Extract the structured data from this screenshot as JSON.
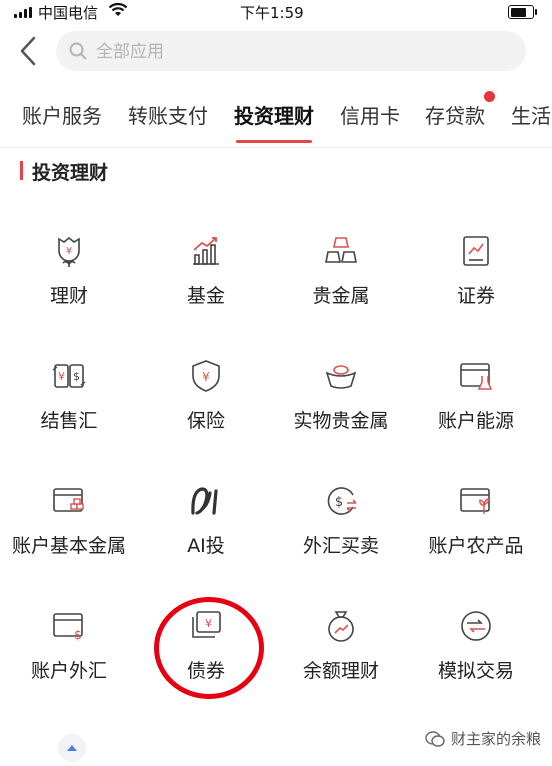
{
  "status_bar": {
    "carrier": "中国电信",
    "time": "下午1:59",
    "battery_level": 0.8
  },
  "search": {
    "placeholder": "全部应用"
  },
  "tabs": [
    {
      "label": "账户服务",
      "active": false
    },
    {
      "label": "转账支付",
      "active": false
    },
    {
      "label": "投资理财",
      "active": true
    },
    {
      "label": "信用卡",
      "active": false
    },
    {
      "label": "存贷款",
      "active": false,
      "has_badge": true
    },
    {
      "label": "生活",
      "active": false
    }
  ],
  "section": {
    "title": "投资理财"
  },
  "items": [
    {
      "label": "理财",
      "icon": "rose-money-icon"
    },
    {
      "label": "基金",
      "icon": "fund-chart-icon"
    },
    {
      "label": "贵金属",
      "icon": "gold-bars-icon"
    },
    {
      "label": "证券",
      "icon": "stock-document-icon"
    },
    {
      "label": "结售汇",
      "icon": "currency-exchange-icon"
    },
    {
      "label": "保险",
      "icon": "shield-yen-icon"
    },
    {
      "label": "实物贵金属",
      "icon": "gold-ingot-icon"
    },
    {
      "label": "账户能源",
      "icon": "energy-card-icon"
    },
    {
      "label": "账户基本金属",
      "icon": "metal-card-icon"
    },
    {
      "label": "AI投",
      "icon": "ai-logo-icon"
    },
    {
      "label": "外汇买卖",
      "icon": "forex-trade-icon"
    },
    {
      "label": "账户农产品",
      "icon": "agri-card-icon"
    },
    {
      "label": "账户外汇",
      "icon": "forex-card-icon"
    },
    {
      "label": "债券",
      "icon": "bond-icon"
    },
    {
      "label": "余额理财",
      "icon": "money-bag-icon"
    },
    {
      "label": "模拟交易",
      "icon": "simulated-trade-icon"
    }
  ],
  "watermark": {
    "text": "财主家的余粮"
  },
  "colors": {
    "accent": "#e64545",
    "annotation": "#e60012",
    "icon_stroke": "#444444",
    "icon_accent": "#d9534f"
  }
}
